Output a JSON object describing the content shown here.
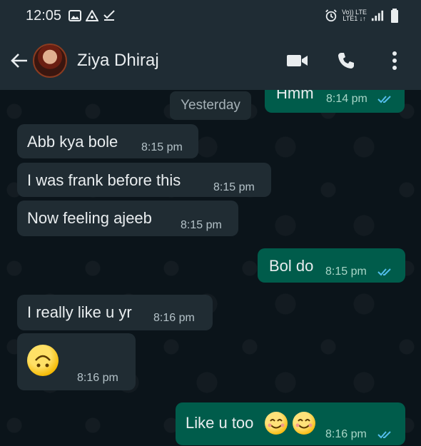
{
  "status_bar": {
    "time": "12:05",
    "network_top": "Vo)) LTE",
    "network_bottom": "LTE1 ↓↑"
  },
  "header": {
    "contact_name": "Ziya Dhiraj"
  },
  "date_separator": "Yesterday",
  "messages": [
    {
      "direction": "out",
      "text": "Hmm",
      "time": "8:14 pm",
      "read": true
    },
    {
      "direction": "in",
      "text": "Abb kya bole",
      "time": "8:15 pm"
    },
    {
      "direction": "in",
      "text": "I was frank before this",
      "time": "8:15 pm"
    },
    {
      "direction": "in",
      "text": "Now feeling ajeeb",
      "time": "8:15 pm"
    },
    {
      "direction": "out",
      "text": "Bol do",
      "time": "8:15 pm",
      "read": true
    },
    {
      "direction": "in",
      "text": "I really like u yr",
      "time": "8:16 pm"
    },
    {
      "direction": "in",
      "text": "",
      "emoji": "upside-down-smile",
      "time": "8:16 pm"
    },
    {
      "direction": "out",
      "text": "Like u too",
      "emoji": "smiling-face x2",
      "time": "8:16 pm",
      "read": true
    }
  ],
  "colors": {
    "header_bg": "#1f2c34",
    "incoming_bubble": "#202c33",
    "outgoing_bubble": "#005c4b",
    "read_tick": "#53bdeb"
  }
}
